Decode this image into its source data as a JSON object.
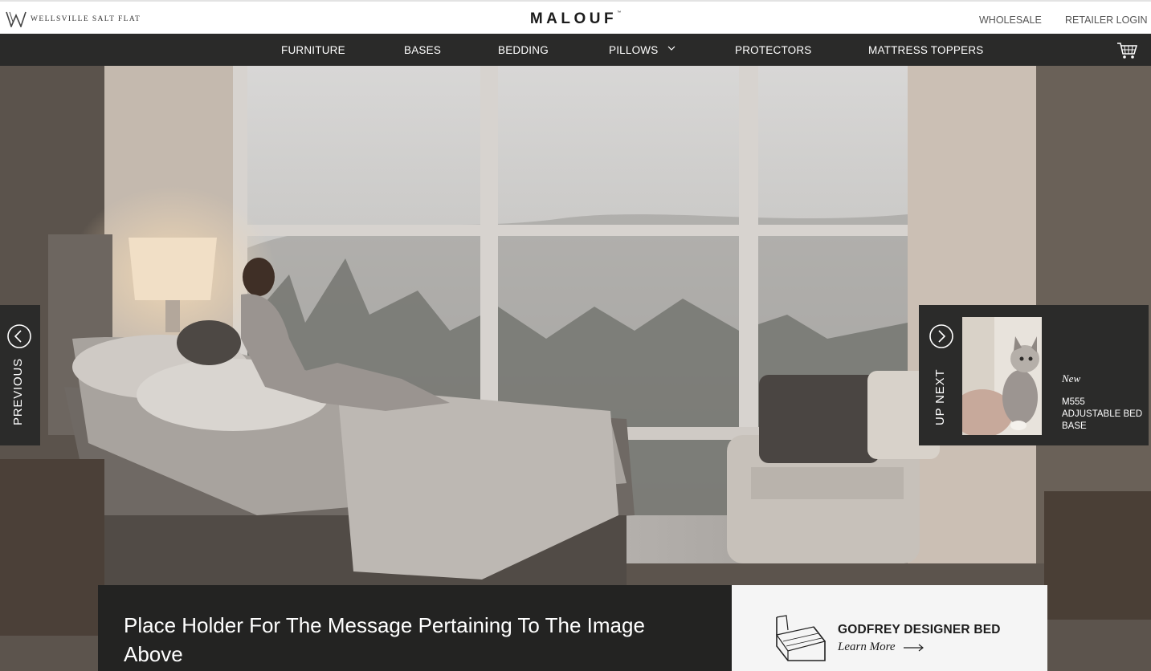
{
  "topbar": {
    "brand_name": "WELLSVILLE SALT FLAT",
    "logo_text": "MALOUF",
    "logo_mark": "™",
    "links": {
      "wholesale": "WHOLESALE",
      "retailer_login": "RETAILER LOGIN"
    }
  },
  "nav": {
    "items": [
      {
        "label": "FURNITURE"
      },
      {
        "label": "BASES"
      },
      {
        "label": "BEDDING"
      },
      {
        "label": "PILLOWS",
        "has_dropdown": true
      },
      {
        "label": "PROTECTORS"
      },
      {
        "label": "MATTRESS TOPPERS"
      }
    ],
    "cart_icon": "shopping-cart-icon"
  },
  "hero": {
    "previous_label": "PREVIOUS",
    "up_next": {
      "label": "UP NEXT",
      "badge": "New",
      "title": "M555 ADJUSTABLE BED BASE"
    },
    "message": "Place Holder For The Message Pertaining To The Image Above",
    "product": {
      "name": "GODFREY DESIGNER BED",
      "link_label": "Learn More"
    }
  },
  "colors": {
    "nav_bg": "#2a2a29",
    "panel_bg": "#2b2b2a",
    "message_bg": "#232322",
    "card_bg": "#f5f5f5"
  }
}
